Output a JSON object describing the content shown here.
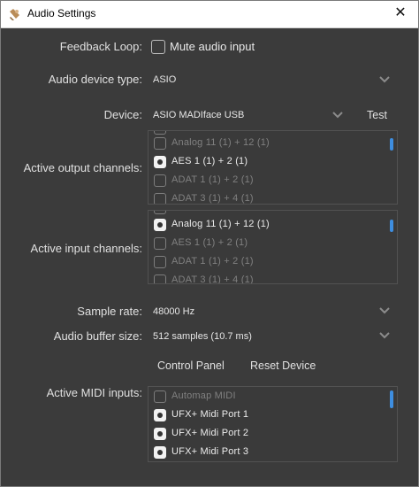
{
  "window": {
    "title": "Audio Settings",
    "close_symbol": "✕"
  },
  "feedback": {
    "label": "Feedback Loop:",
    "checkbox_label": "Mute audio input",
    "checked": false
  },
  "device_type": {
    "label": "Audio device type:",
    "value": "ASIO"
  },
  "device": {
    "label": "Device:",
    "value": "ASIO MADIface USB",
    "test_label": "Test"
  },
  "output_channels": {
    "label": "Active output channels:",
    "items": [
      {
        "label": "Analog 11 (1) + 12 (1)",
        "checked": false
      },
      {
        "label": "AES 1 (1) + 2 (1)",
        "checked": true
      },
      {
        "label": "ADAT 1 (1) + 2 (1)",
        "checked": false
      },
      {
        "label": "ADAT 3 (1) + 4 (1)",
        "checked": false
      }
    ]
  },
  "input_channels": {
    "label": "Active input channels:",
    "items": [
      {
        "label": "Analog 11 (1) + 12 (1)",
        "checked": true
      },
      {
        "label": "AES 1 (1) + 2 (1)",
        "checked": false
      },
      {
        "label": "ADAT 1 (1) + 2 (1)",
        "checked": false
      },
      {
        "label": "ADAT 3 (1) + 4 (1)",
        "checked": false
      }
    ]
  },
  "sample_rate": {
    "label": "Sample rate:",
    "value": "48000 Hz"
  },
  "buffer_size": {
    "label": "Audio buffer size:",
    "value": "512 samples (10.7 ms)"
  },
  "buttons": {
    "control_panel": "Control Panel",
    "reset_device": "Reset Device"
  },
  "midi_inputs": {
    "label": "Active MIDI inputs:",
    "items": [
      {
        "label": "Automap MIDI",
        "checked": false
      },
      {
        "label": "UFX+ Midi Port 1",
        "checked": true
      },
      {
        "label": "UFX+ Midi Port 2",
        "checked": true
      },
      {
        "label": "UFX+ Midi Port 3",
        "checked": true
      }
    ]
  },
  "colors": {
    "background": "#3b3b3b",
    "accent": "#3e8ee0",
    "text": "#e0e0e0",
    "dim_text": "#808080"
  },
  "icons": {
    "app": "speaker-app-icon",
    "close": "close-icon",
    "dropdown": "chevron-down-icon"
  }
}
